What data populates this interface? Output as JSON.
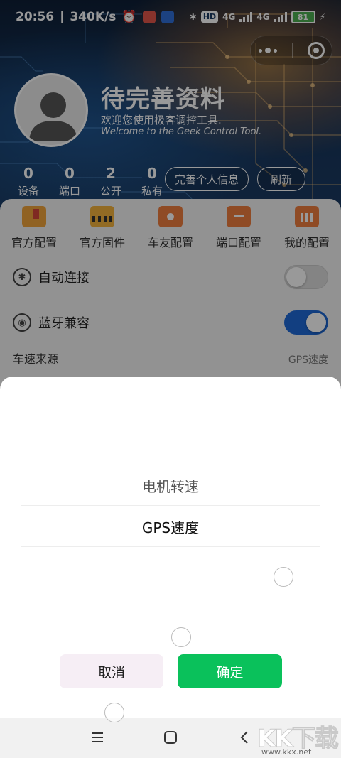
{
  "status_bar": {
    "time": "20:56",
    "speed": "340K/s",
    "hd_label": "HD",
    "net1": "4G",
    "net2": "4G",
    "battery": "81"
  },
  "profile": {
    "name": "待完善资料",
    "welcome_cn": "欢迎您使用极客调控工具.",
    "welcome_en": "Welcome to the Geek Control Tool."
  },
  "stats": [
    {
      "num": "0",
      "label": "设备"
    },
    {
      "num": "0",
      "label": "端口"
    },
    {
      "num": "2",
      "label": "公开"
    },
    {
      "num": "0",
      "label": "私有"
    }
  ],
  "header_buttons": {
    "complete_profile": "完善个人信息",
    "refresh": "刷新"
  },
  "quick_menu": [
    {
      "label": "官方配置",
      "icon": "folder-bookmark-icon",
      "color": "#f1a33b"
    },
    {
      "label": "官方固件",
      "icon": "folder-stripes-icon",
      "color": "#f3b33c"
    },
    {
      "label": "车友配置",
      "icon": "calendar-car-icon",
      "color": "#ef7d3e"
    },
    {
      "label": "端口配置",
      "icon": "calendar-port-icon",
      "color": "#ef7d3e"
    },
    {
      "label": "我的配置",
      "icon": "calendar-grid-icon",
      "color": "#ef7d3e"
    }
  ],
  "settings": [
    {
      "label": "自动连接",
      "icon": "bluetooth-icon",
      "on": false
    },
    {
      "label": "蓝牙兼容",
      "icon": "signal-icon",
      "on": true
    }
  ],
  "partial_row": {
    "label": "车速来源",
    "value": "GPS速度"
  },
  "sheet": {
    "options": [
      "电机转速",
      "GPS速度"
    ],
    "cancel": "取消",
    "confirm": "确定"
  },
  "watermark": {
    "logo": "KK下载",
    "url": "www.kkx.net"
  },
  "colors": {
    "accent": "#0ac15b",
    "toggle_on": "#1e6ad8",
    "cancel_bg": "#f6eef5"
  }
}
